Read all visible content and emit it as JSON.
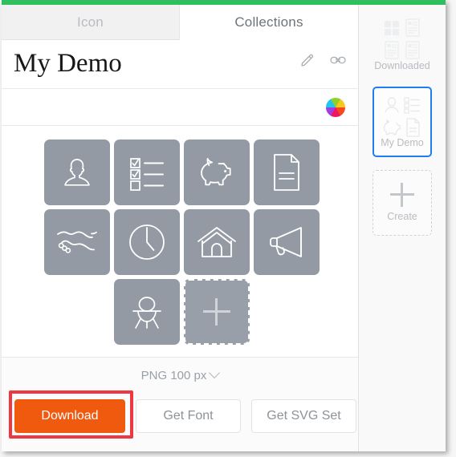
{
  "window": {
    "accent_top_bar_color": "#2fbf5c"
  },
  "tabs": [
    {
      "label": "Icon",
      "active": false
    },
    {
      "label": "Collections",
      "active": true
    }
  ],
  "collection": {
    "title": "My Demo",
    "edit_icon": "pencil-icon",
    "link_icon": "link-icon",
    "color_wheel_icon": "color-wheel-icon"
  },
  "icon_grid": {
    "tiles": [
      {
        "name": "user-avatar-icon"
      },
      {
        "name": "checklist-icon"
      },
      {
        "name": "piggy-bank-icon"
      },
      {
        "name": "document-icon"
      },
      {
        "name": "handshake-icon"
      },
      {
        "name": "clock-icon"
      },
      {
        "name": "home-icon"
      },
      {
        "name": "megaphone-icon"
      },
      {
        "name": "construction-worker-icon"
      }
    ],
    "add_tile": {
      "name": "add-icon-tile",
      "glyph": "plus-icon"
    },
    "tile_color": "#939aa3"
  },
  "bottom_bar": {
    "format_label": "PNG 100 px",
    "format_chevron": "chevron-down-icon",
    "buttons": [
      {
        "label": "Download",
        "style": "primary"
      },
      {
        "label": "Get Font",
        "style": "ghost"
      },
      {
        "label": "Get SVG Set",
        "style": "ghost"
      }
    ],
    "primary_color": "#ef5a0f",
    "highlight_color": "#ef3742"
  },
  "sidebar": {
    "cards": [
      {
        "label": "Downloaded",
        "selected": false
      },
      {
        "label": "My Demo",
        "selected": true
      },
      {
        "label": "Create",
        "selected": false,
        "glyph": "plus-icon"
      }
    ],
    "selected_border_color": "#1e7ef0"
  }
}
